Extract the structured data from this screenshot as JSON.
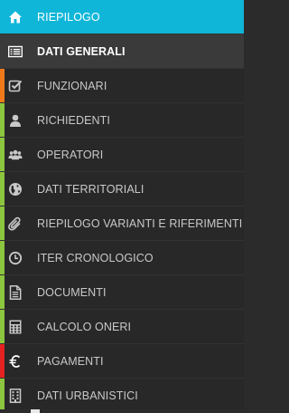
{
  "menu": {
    "items": [
      {
        "label": "RIEPILOGO",
        "icon": "home-icon",
        "state": "active",
        "bar_color": ""
      },
      {
        "label": "DATI GENERALI",
        "icon": "list-icon",
        "state": "selected",
        "bar_color": ""
      },
      {
        "label": "FUNZIONARI",
        "icon": "checkbox-icon",
        "state": "normal",
        "bar_color": "#f07a1a"
      },
      {
        "label": "RICHIEDENTI",
        "icon": "user-icon",
        "state": "normal",
        "bar_color": "#8cc63f"
      },
      {
        "label": "OPERATORI",
        "icon": "users-icon",
        "state": "normal",
        "bar_color": "#8cc63f"
      },
      {
        "label": "DATI TERRITORIALI",
        "icon": "globe-icon",
        "state": "normal",
        "bar_color": "#8cc63f"
      },
      {
        "label": "RIEPILOGO VARIANTI E RIFERIMENTI",
        "icon": "paperclip-icon",
        "state": "normal",
        "bar_color": "#8cc63f"
      },
      {
        "label": "ITER CRONOLOGICO",
        "icon": "clock-icon",
        "state": "normal",
        "bar_color": "#8cc63f"
      },
      {
        "label": "DOCUMENTI",
        "icon": "document-icon",
        "state": "normal",
        "bar_color": "#8cc63f"
      },
      {
        "label": "CALCOLO ONERI",
        "icon": "calculator-icon",
        "state": "normal",
        "bar_color": "#8cc63f"
      },
      {
        "label": "PAGAMENTI",
        "icon": "euro-icon",
        "state": "normal",
        "bar_color": "#e52121"
      },
      {
        "label": "DATI URBANISTICI",
        "icon": "building-icon",
        "state": "normal",
        "bar_color": "#8cc63f"
      }
    ]
  },
  "colors": {
    "accent": "#0fb6d8",
    "sidebar_bg": "#282828",
    "selected_bg": "#3a3a3a",
    "orange": "#f07a1a",
    "green": "#8cc63f",
    "red": "#e52121"
  }
}
